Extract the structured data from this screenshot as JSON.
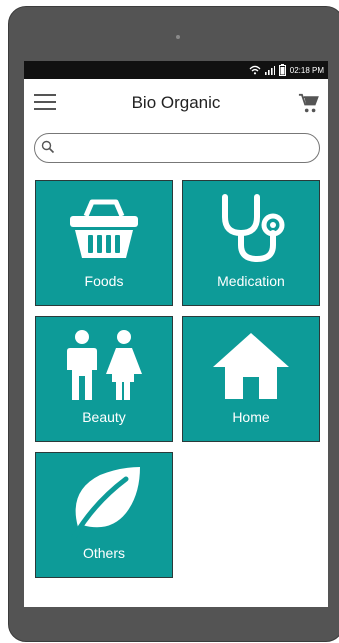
{
  "status": {
    "time": "02:18 PM"
  },
  "header": {
    "title": "Bio Organic"
  },
  "search": {
    "placeholder": "",
    "value": ""
  },
  "categories": [
    {
      "label": "Foods",
      "icon": "basket-icon"
    },
    {
      "label": "Medication",
      "icon": "stethoscope-icon"
    },
    {
      "label": "Beauty",
      "icon": "man-woman-icon"
    },
    {
      "label": "Home",
      "icon": "house-icon"
    },
    {
      "label": "Others",
      "icon": "leaf-icon"
    }
  ],
  "colors": {
    "tile": "#0d9b98",
    "frame": "#545454",
    "statusbar": "#111111"
  }
}
